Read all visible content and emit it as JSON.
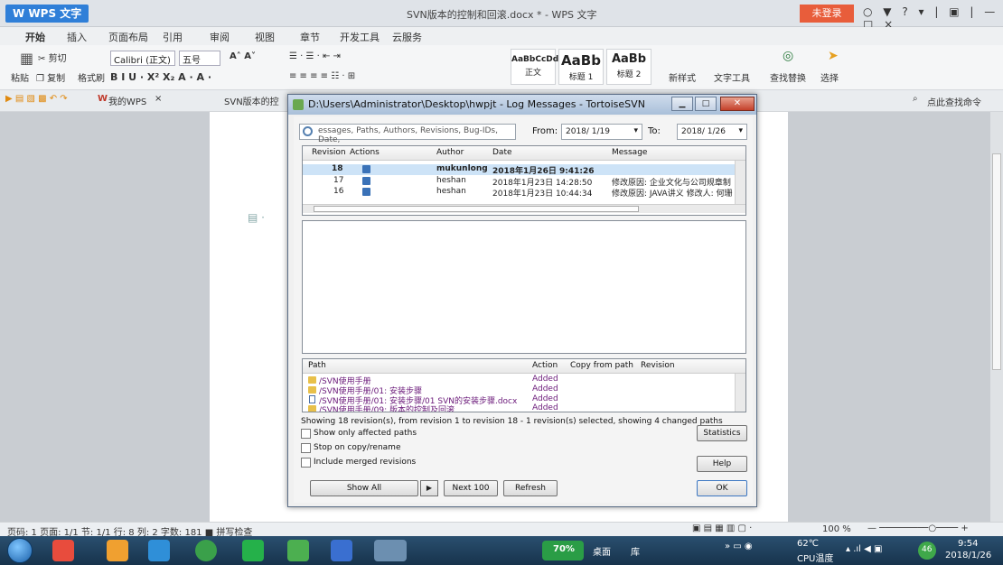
{
  "wps": {
    "app_label": "W WPS 文字",
    "doc_title": "SVN版本的控制和回滚.docx * - WPS 文字",
    "login_label": "未登录",
    "window_controls": "○ ▼ ? ▾ | ▣ | — □ ×",
    "ribbon_tabs": [
      "开始",
      "插入",
      "页面布局",
      "引用",
      "审阅",
      "视图",
      "章节",
      "开发工具",
      "云服务"
    ],
    "ribbon": {
      "cut": "剪切",
      "copy": "复制",
      "format_painter": "格式刷",
      "paste": "粘贴",
      "font_name": "Calibri (正文)",
      "font_size": "五号",
      "style_normal_preview": "AaBbCcDd",
      "style_normal": "正文",
      "style_h1_preview": "AaBb",
      "style_h1": "标题 1",
      "style_h2_preview": "AaBb",
      "style_h2": "标题 2",
      "new_style": "新样式",
      "text_tools": "文字工具",
      "find_replace": "查找替换",
      "select": "选择"
    },
    "doc_tabs": {
      "my_wps": "我的WPS",
      "svn_doc": "SVN版本的控"
    },
    "search_command": "点此查找命令",
    "status_text": "页码: 1  页面: 1/1  节: 1/1  行: 8  列: 2  字数: 181  ■ 拼写检查",
    "zoom_text": "100 %"
  },
  "dialog": {
    "title": "D:\\Users\\Administrator\\Desktop\\hwpjt - Log Messages - TortoiseSVN",
    "filter_placeholder": "essages, Paths, Authors, Revisions, Bug-IDs, Date,",
    "from_label": "From:",
    "from_value": "2018/ 1/19",
    "to_label": "To:",
    "to_value": "2018/ 1/26",
    "log_columns": [
      "Revision",
      "Actions",
      "Author",
      "Date",
      "Message"
    ],
    "log_rows": [
      {
        "revision": "18",
        "author": "mukunlong",
        "date": "2018年1月26日 9:41:26",
        "message": ""
      },
      {
        "revision": "17",
        "author": "heshan",
        "date": "2018年1月23日 14:28:50",
        "message": "修改原因: 企业文化与公司规章制"
      },
      {
        "revision": "16",
        "author": "heshan",
        "date": "2018年1月23日 10:44:34",
        "message": "修改原因: JAVA讲义 修改人: 何珊"
      }
    ],
    "path_columns": [
      "Path",
      "Action",
      "Copy from path",
      "Revision"
    ],
    "path_rows": [
      {
        "path": "/SVN使用手册",
        "action": "Added",
        "type": "folder"
      },
      {
        "path": "/SVN使用手册/01: 安装步骤",
        "action": "Added",
        "type": "folder"
      },
      {
        "path": "/SVN使用手册/01: 安装步骤/01 SVN的安装步骤.docx",
        "action": "Added",
        "type": "file"
      },
      {
        "path": "/SVN使用手册/09: 版本的控制及回滚",
        "action": "Added",
        "type": "folder"
      }
    ],
    "summary": "Showing 18 revision(s), from revision 1 to revision 18 - 1 revision(s) selected, showing 4 changed paths",
    "checkboxes": [
      {
        "label": "Show only affected paths"
      },
      {
        "label": "Stop on copy/rename"
      },
      {
        "label": "Include merged revisions"
      }
    ],
    "buttons": {
      "statistics": "Statistics",
      "help": "Help",
      "show_all": "Show All",
      "next_100": "Next 100",
      "refresh": "Refresh",
      "ok": "OK"
    }
  },
  "taskbar": {
    "battery": "70%",
    "desktop": "桌面",
    "library": "库",
    "temperature": "62℃",
    "cpu_label": "CPU温度",
    "badge": "46",
    "time": "9:54",
    "date": "2018/1/26"
  },
  "colors": {
    "wps_blue": "#2f7fd8",
    "login_red": "#e85d3b",
    "selection": "#cde3f7",
    "path_purple": "#6b1a7a"
  }
}
